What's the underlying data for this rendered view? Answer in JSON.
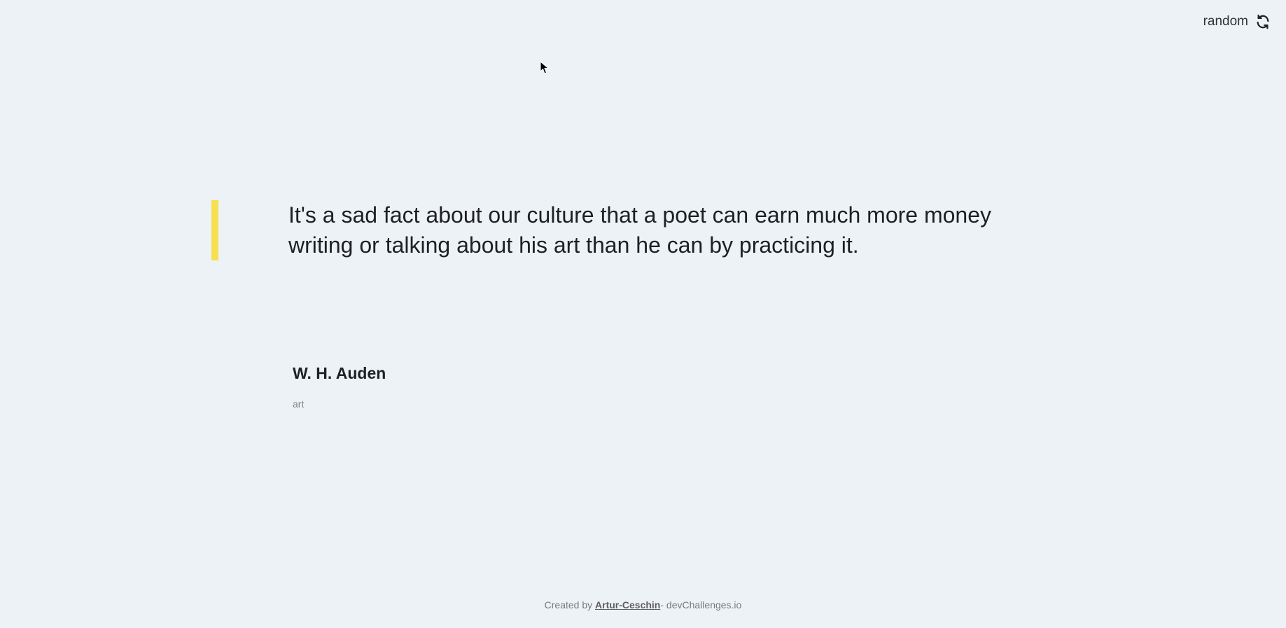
{
  "header": {
    "random_label": "random",
    "random_icon": "refresh-icon"
  },
  "quote": {
    "text": "It's a sad fact about our culture that a poet can earn much more money writing or talking about his art than he can by practicing it.",
    "accent_color": "#f7df4f"
  },
  "author": {
    "name": "W. H. Auden",
    "genre": "art"
  },
  "footer": {
    "prefix": "Created by ",
    "author_link": "Artur-Ceschin",
    "suffix": "- devChallenges.io"
  },
  "colors": {
    "background": "#edf2f7",
    "text": "#1f2023",
    "muted": "#828282"
  }
}
